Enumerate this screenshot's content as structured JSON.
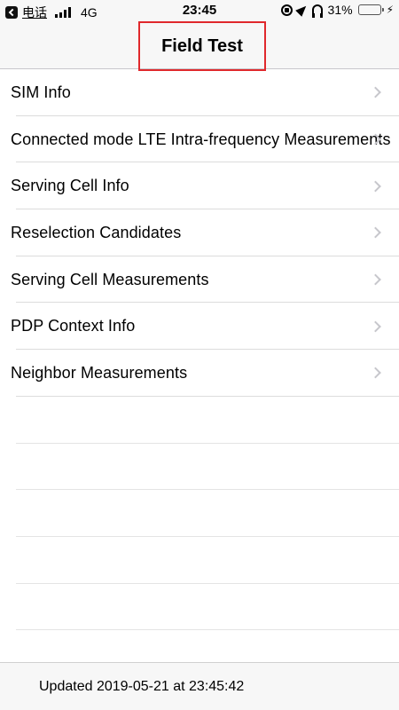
{
  "status_bar": {
    "carrier": "电话",
    "network": "4G",
    "time": "23:45",
    "battery_percent": "31%",
    "battery_level": 0.31,
    "battery_color": "#4cd964"
  },
  "nav": {
    "title": "Field Test",
    "highlight_color": "#e0282c"
  },
  "menu": {
    "items": [
      {
        "label": "SIM Info"
      },
      {
        "label": "Connected mode LTE Intra-frequency Measurements"
      },
      {
        "label": "Serving Cell Info"
      },
      {
        "label": "Reselection Candidates"
      },
      {
        "label": "Serving Cell Measurements"
      },
      {
        "label": "PDP Context Info"
      },
      {
        "label": "Neighbor Measurements"
      }
    ],
    "chevron_icon": "chevron-right-icon"
  },
  "footer": {
    "updated_text": "Updated 2019-05-21 at 23:45:42"
  }
}
